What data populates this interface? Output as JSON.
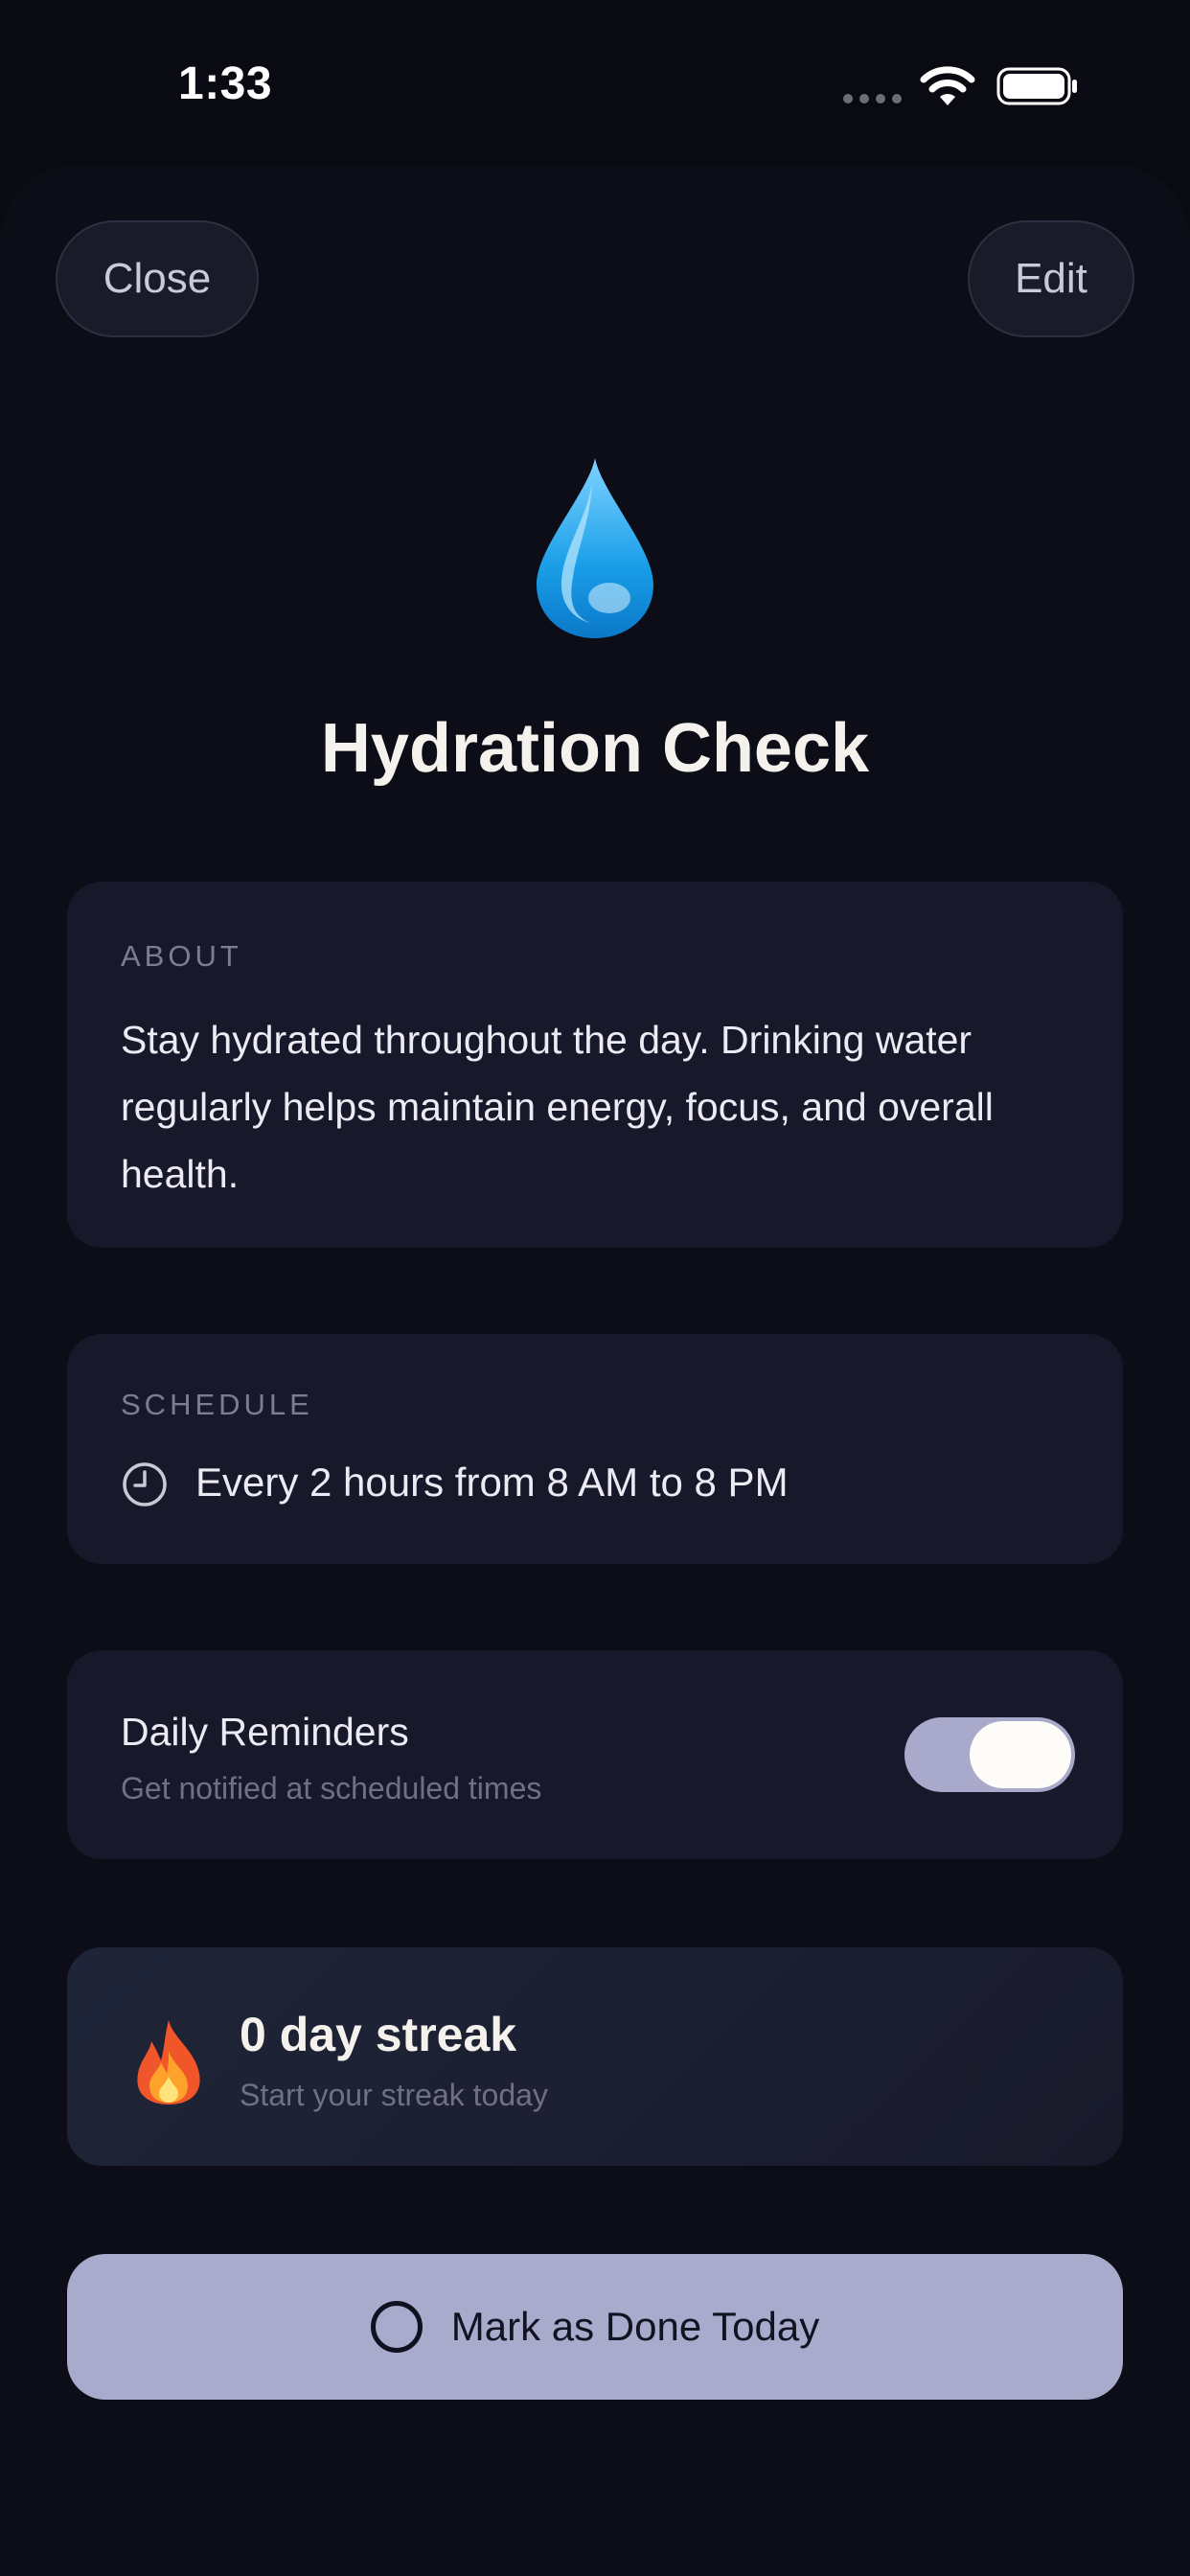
{
  "status_bar": {
    "time": "1:33"
  },
  "header": {
    "close_label": "Close",
    "edit_label": "Edit"
  },
  "habit": {
    "icon": "water-drop-icon",
    "title": "Hydration Check"
  },
  "about": {
    "label": "ABOUT",
    "text": "Stay hydrated throughout the day. Drinking water regularly helps maintain energy, focus, and overall health."
  },
  "schedule": {
    "label": "SCHEDULE",
    "icon": "clock-icon",
    "text": "Every 2 hours from 8 AM to 8 PM"
  },
  "reminders": {
    "title": "Daily Reminders",
    "subtitle": "Get notified at scheduled times",
    "enabled": true
  },
  "streak": {
    "icon": "fire-icon",
    "title": "0 day streak",
    "subtitle": "Start your streak today"
  },
  "action": {
    "label": "Mark as Done Today",
    "icon": "empty-circle-icon"
  },
  "colors": {
    "background": "#0a0b12",
    "card": "#171829",
    "accent": "#a9abcc",
    "title": "#f5f2ee"
  }
}
